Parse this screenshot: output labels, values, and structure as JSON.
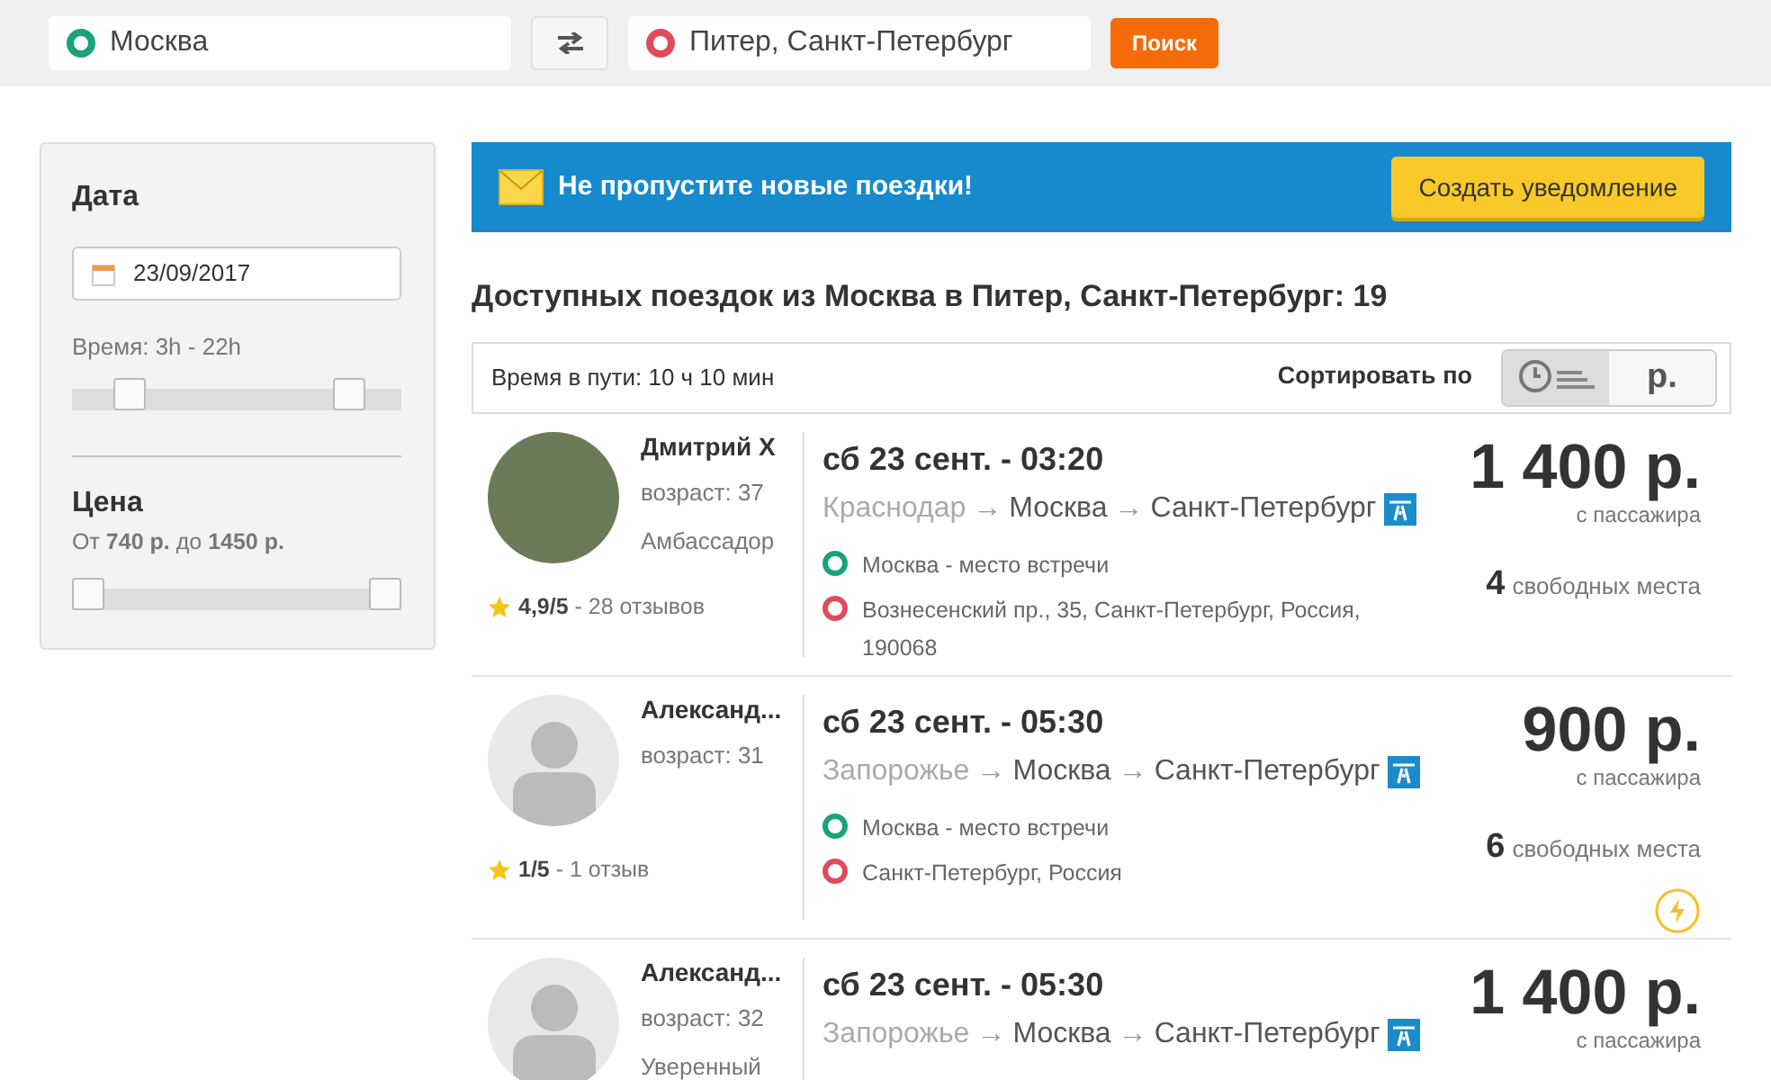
{
  "search": {
    "from": "Москва",
    "to": "Питер, Санкт-Петербург",
    "button": "Поиск"
  },
  "filters": {
    "date_title": "Дата",
    "date": "23/09/2017",
    "time_label": "Время: 3h - 22h",
    "time_thumbs": [
      {
        "level": 0.14
      },
      {
        "level": 0.88
      }
    ],
    "price_title": "Цена",
    "price_label": "От **740 р.** до **1450 р.**",
    "price_thumbs": [
      {
        "level": 0
      },
      {
        "level": 1
      }
    ]
  },
  "alert": {
    "text": "Не пропустите новые поездки!",
    "button": "Создать уведомление"
  },
  "results_title": "Доступных поездок из Москва в Питер, Санкт-Петербург: 19",
  "toolbar": {
    "duration": "Время в пути: 10 ч 10 мин",
    "sort_label": "Сортировать по",
    "sort_options": [
      {
        "kind": "time",
        "selected": true
      },
      {
        "kind": "price",
        "label": "р.",
        "selected": false
      }
    ]
  },
  "trips": [
    {
      "has_photo": true,
      "name": "Дмитрий Х",
      "age": "возраст: 37",
      "level": "Амбассадор",
      "rating": "4,9/5",
      "reviews": "- 28 отзывов",
      "date": "сб 23 сент. - 03:20",
      "route": [
        {
          "city": "Краснодар",
          "passed": true
        },
        {
          "arrow": "→",
          "city": "Москва",
          "passed": false
        },
        {
          "arrow": "→",
          "city": "Санкт-Петербург",
          "passed": false
        }
      ],
      "highway": true,
      "stops": [
        {
          "kind": "from",
          "text": "Москва - место встречи"
        },
        {
          "kind": "to",
          "text": "Вознесенский пр., 35, Санкт-Петербург, Россия, 190068"
        }
      ],
      "price": "1 400 р.",
      "price_note": "с пассажира",
      "seats": "4",
      "seats_label": "свободных места",
      "instant": false
    },
    {
      "has_photo": false,
      "name": "Александ...",
      "age": "возраст: 31",
      "rating": "1/5",
      "reviews": "- 1 отзыв",
      "date": "сб 23 сент. - 05:30",
      "route": [
        {
          "city": "Запорожье",
          "passed": true
        },
        {
          "arrow": "→",
          "city": "Москва",
          "passed": false
        },
        {
          "arrow": "→",
          "city": "Санкт-Петербург",
          "passed": false
        }
      ],
      "highway": true,
      "stops": [
        {
          "kind": "from",
          "text": "Москва - место встречи"
        },
        {
          "kind": "to",
          "text": "Санкт-Петербург, Россия"
        }
      ],
      "price": "900 р.",
      "price_note": "с пассажира",
      "seats": "6",
      "seats_label": "свободных места",
      "instant": true
    },
    {
      "has_photo": false,
      "name": "Александ...",
      "age": "возраст: 32",
      "level": "Уверенный",
      "date": "сб 23 сент. - 05:30",
      "route": [
        {
          "city": "Запорожье",
          "passed": true
        },
        {
          "arrow": "→",
          "city": "Москва",
          "passed": false
        },
        {
          "arrow": "→",
          "city": "Санкт-Петербург",
          "passed": false
        }
      ],
      "highway": true,
      "price": "1 400 р.",
      "price_note": "с пассажира",
      "instant": false
    }
  ]
}
